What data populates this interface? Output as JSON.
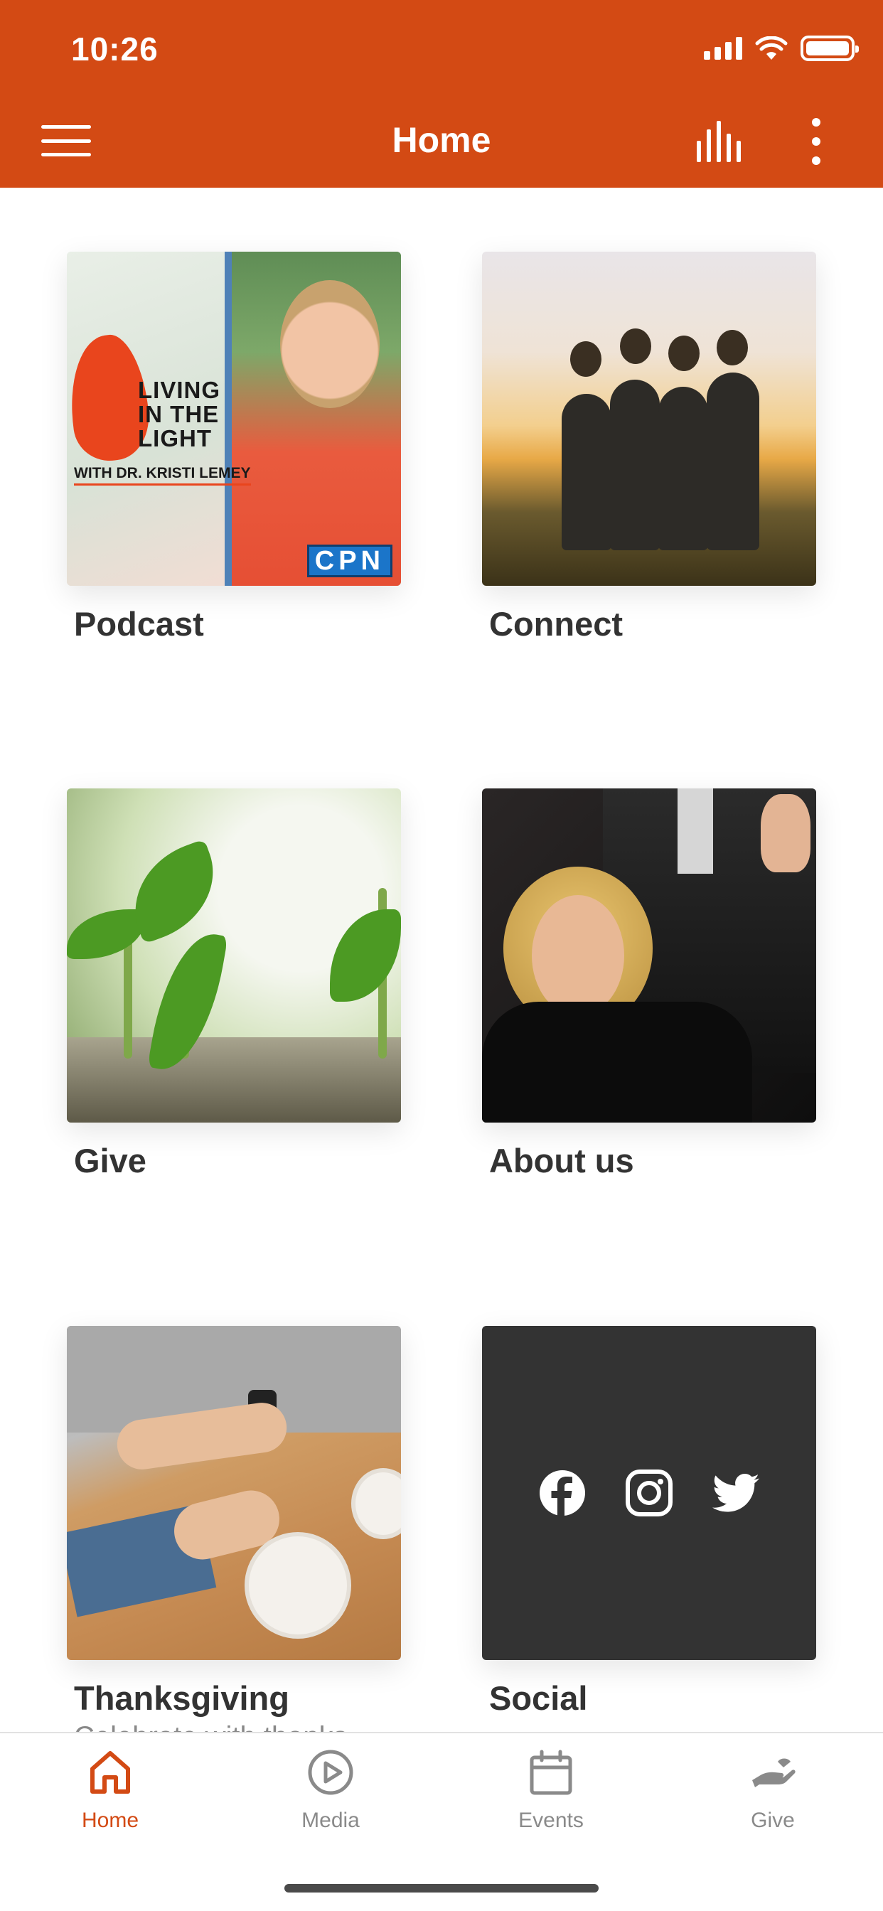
{
  "status_bar": {
    "time": "10:26"
  },
  "header": {
    "title": "Home",
    "background_color": "#D34A14"
  },
  "tiles": [
    {
      "label": "Podcast",
      "image_text": {
        "brand_line1": "LIVING",
        "brand_line2": "IN THE",
        "brand_line3": "LIGHT",
        "byline": "WITH DR. KRISTI LEMEY",
        "network": "CPN"
      }
    },
    {
      "label": "Connect"
    },
    {
      "label": "Give"
    },
    {
      "label": "About us"
    },
    {
      "label": "Thanksgiving",
      "subtitle": "Celebrate with thanks"
    },
    {
      "label": "Social",
      "icons": [
        "facebook-icon",
        "instagram-icon",
        "twitter-icon"
      ]
    }
  ],
  "tabbar": {
    "accent_color": "#D34A14",
    "items": [
      {
        "label": "Home",
        "icon": "home-icon",
        "active": true
      },
      {
        "label": "Media",
        "icon": "play-circle-icon",
        "active": false
      },
      {
        "label": "Events",
        "icon": "calendar-icon",
        "active": false
      },
      {
        "label": "Give",
        "icon": "giving-hand-icon",
        "active": false
      }
    ]
  }
}
